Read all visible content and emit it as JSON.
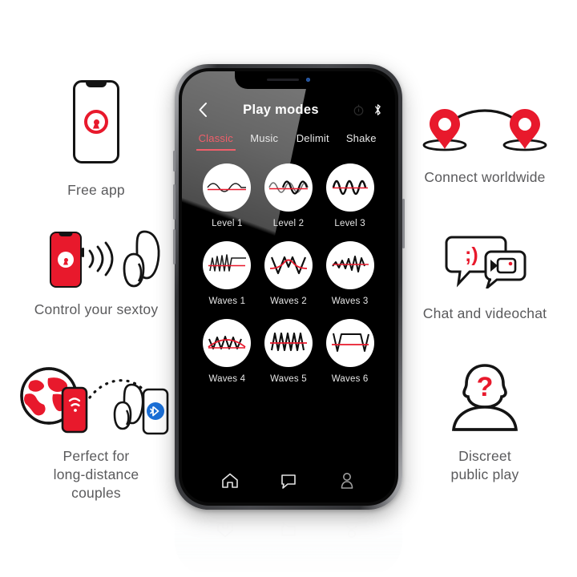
{
  "brand": {
    "red": "#e8192c",
    "accent_tab": "#f15f6a",
    "caption_gray": "#5a5a5c"
  },
  "phone": {
    "header": {
      "back_icon": "chevron-left-icon",
      "title": "Play modes",
      "status_icons": [
        "location-compass-icon",
        "bluetooth-icon"
      ]
    },
    "tabs": [
      {
        "label": "Classic",
        "active": true
      },
      {
        "label": "Music",
        "active": false
      },
      {
        "label": "Delimit",
        "active": false
      },
      {
        "label": "Shake",
        "active": false
      }
    ],
    "modes": [
      {
        "label": "Level 1",
        "wave": "sine-low"
      },
      {
        "label": "Level 2",
        "wave": "sine-mid"
      },
      {
        "label": "Level 3",
        "wave": "sine-high"
      },
      {
        "label": "Waves 1",
        "wave": "ramp-plateau"
      },
      {
        "label": "Waves 2",
        "wave": "zigzag-vw"
      },
      {
        "label": "Waves 3",
        "wave": "zigzag-grow"
      },
      {
        "label": "Waves 4",
        "wave": "zigzag-arc"
      },
      {
        "label": "Waves 5",
        "wave": "triangle-dense"
      },
      {
        "label": "Waves 6",
        "wave": "trapezoid"
      }
    ],
    "bottom_nav": [
      {
        "icon": "home-icon",
        "label": "Home"
      },
      {
        "icon": "chat-icon",
        "label": "Chat"
      },
      {
        "icon": "profile-icon",
        "label": "Profile"
      }
    ]
  },
  "features": {
    "free_app": {
      "caption": "Free app",
      "icon": "phone-with-app-logo-icon"
    },
    "control_sextoy": {
      "caption": "Control your sextoy",
      "icon": "phone-signal-toy-icon"
    },
    "long_distance": {
      "caption": "Perfect for\nlong-distance\ncouples",
      "icon": "globe-phone-toy-bluetooth-icon"
    },
    "connect_worldwide": {
      "caption": "Connect worldwide",
      "icon": "two-map-pins-arc-icon"
    },
    "chat_videochat": {
      "caption": "Chat and videochat",
      "icon": "speech-bubbles-video-icon"
    },
    "discreet_play": {
      "caption": "Discreet\npublic play",
      "icon": "anonymous-person-question-icon"
    }
  }
}
